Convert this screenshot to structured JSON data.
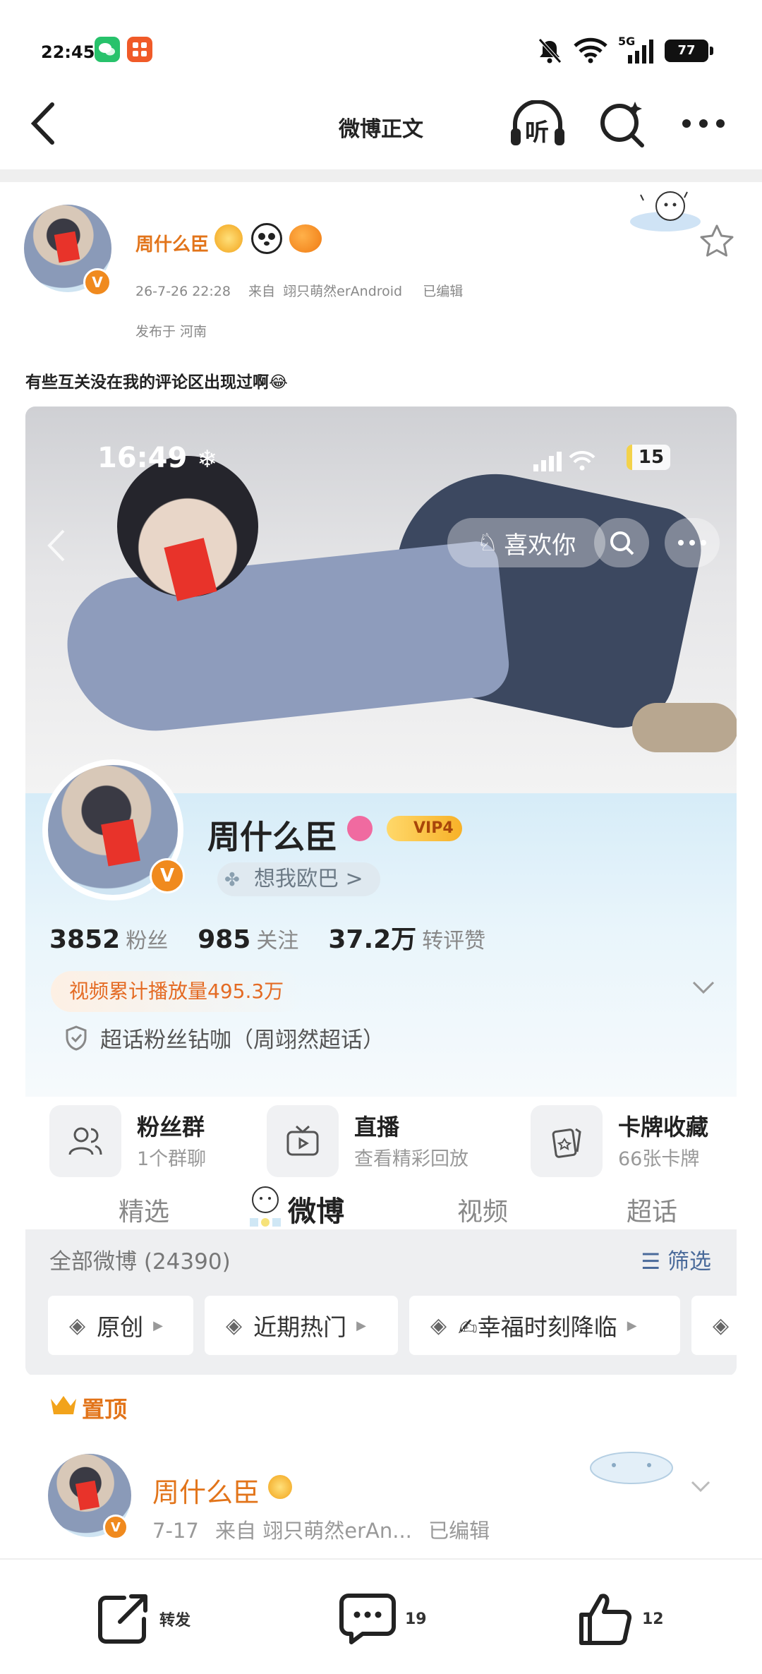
{
  "status_bar": {
    "time": "22:45",
    "battery": "77",
    "network": "5G"
  },
  "nav": {
    "title": "微博正文",
    "listen_label": "听"
  },
  "post": {
    "author": "周什么臣",
    "date": "26-7-26 22:28",
    "source_prefix": "来自",
    "source": "翊只萌然erAndroid",
    "edited": "已编辑",
    "location": "发布于 河南",
    "text": "有些互关没在我的评论区出现过啊😂"
  },
  "embedded": {
    "status_time": "16:49",
    "battery": "15",
    "like_pill": "喜欢你",
    "profile_name": "周什么臣",
    "vip_label": "VIP4",
    "miss_label": "想我欧巴 >",
    "stats": [
      {
        "num": "3852",
        "label": "粉丝"
      },
      {
        "num": "985",
        "label": "关注"
      },
      {
        "num": "37.2万",
        "label": "转评赞"
      }
    ],
    "play_count": "视频累计播放量495.3万",
    "superchat": "超话粉丝钻咖（周翊然超话）",
    "tools": [
      {
        "title": "粉丝群",
        "sub": "1个群聊"
      },
      {
        "title": "直播",
        "sub": "查看精彩回放"
      },
      {
        "title": "卡牌收藏",
        "sub": "66张卡牌"
      }
    ],
    "tabs": [
      "精选",
      "微博",
      "视频",
      "超话"
    ],
    "all_posts": "全部微博 (24390)",
    "filter": "筛选",
    "chips": [
      "原创",
      "近期热门",
      "✍幸福时刻降临"
    ],
    "pinned": "置顶",
    "pinned_post": {
      "author": "周什么臣",
      "date": "7-17",
      "source": "来自 翊只萌然erAn...",
      "edited": "已编辑"
    }
  },
  "bottom_bar": {
    "repost": "转发",
    "comments": "19",
    "likes": "12"
  },
  "colors": {
    "accent_orange": "#e2741a",
    "link_blue": "#4a6a9a",
    "vip_gold": "#f7b128"
  }
}
